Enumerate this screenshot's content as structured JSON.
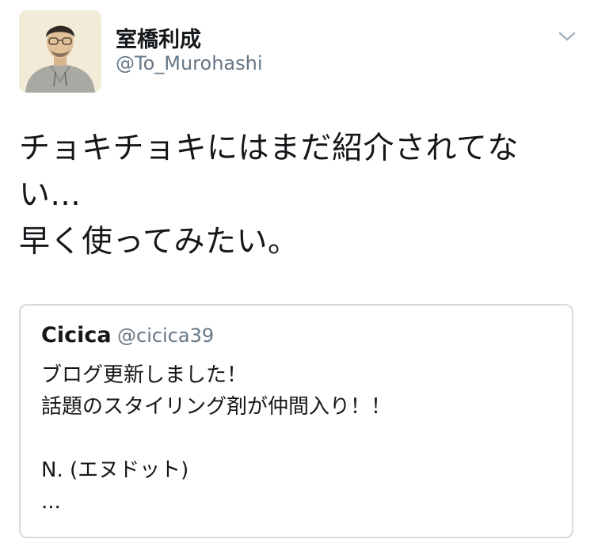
{
  "author": {
    "display_name": "室橋利成",
    "handle": "@To_Murohashi"
  },
  "tweet": {
    "text_lines": [
      "チョキチョキにはまだ紹介されてな",
      "い...",
      "早く使ってみたい。"
    ]
  },
  "quoted_tweet": {
    "display_name": "Cicica",
    "handle": "@cicica39",
    "text_lines": [
      "ブログ更新しました！",
      "話題のスタイリング剤が仲間入り！！",
      "",
      "N. (エヌドット)",
      "..."
    ]
  },
  "icons": {
    "menu": "chevron-down-icon",
    "avatar": "user-avatar"
  },
  "colors": {
    "text": "#14171a",
    "secondary_text": "#657786",
    "border": "#d6dbe0",
    "chevron": "#aab8c2"
  }
}
